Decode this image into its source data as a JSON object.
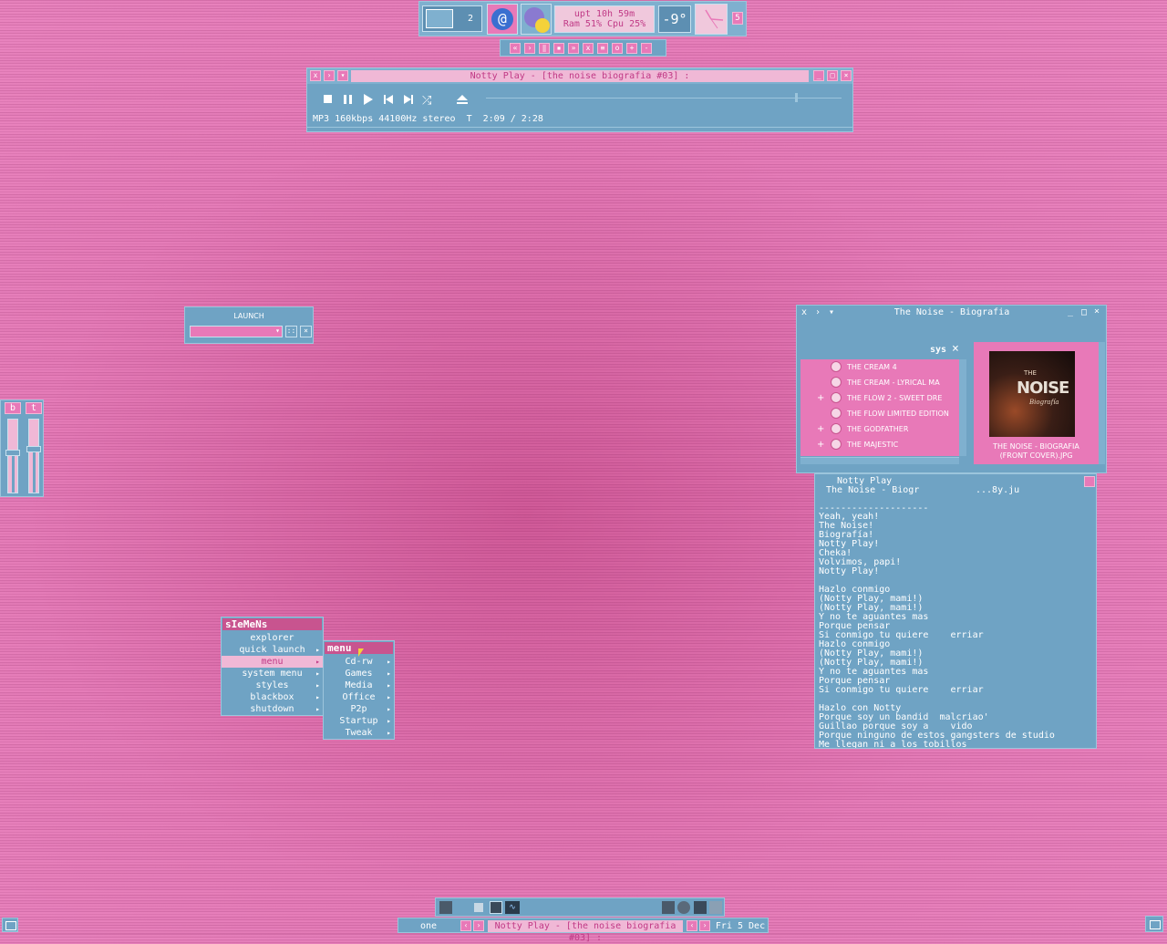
{
  "top_toolbar": {
    "workspace_number": "2",
    "sysinfo_line1": "upt 10h 59m",
    "sysinfo_line2": "Ram 51% Cpu 25%",
    "temperature": "-9°",
    "right_badge": "5"
  },
  "media_controls_strip": [
    "prev",
    "play",
    "pause",
    "stop",
    "next",
    "shuffle",
    "playlist",
    "eq",
    "vol-up",
    "vol-down"
  ],
  "player": {
    "title": "Notty Play - [the noise biografia #03] :",
    "status": "MP3 160kbps 44100Hz stereo  T  2:09 / 2:28",
    "progress": 0.87
  },
  "launch": {
    "title": "LAUNCH",
    "value": ""
  },
  "sliders": {
    "left_label": "b",
    "right_label": "t",
    "left_level": 0.55,
    "right_level": 0.6
  },
  "menu": {
    "title": "sIeMeNs",
    "items": [
      {
        "label": "explorer",
        "arrow": false
      },
      {
        "label": "quick launch",
        "arrow": true
      },
      {
        "label": "menu",
        "arrow": true,
        "active": true
      },
      {
        "label": "system menu",
        "arrow": true
      },
      {
        "label": "styles",
        "arrow": true
      },
      {
        "label": "blackbox",
        "arrow": true
      },
      {
        "label": "shutdown",
        "arrow": true
      }
    ],
    "submenu_title": "menu",
    "submenu_items": [
      "Cd-rw",
      "Games",
      "Media",
      "Office",
      "P2p",
      "Startup",
      "Tweak"
    ]
  },
  "browser": {
    "title": "The Noise - Biografia",
    "tree_header": "sys",
    "tree_items": [
      {
        "label": "THE CREAM 4",
        "expand": ""
      },
      {
        "label": "THE CREAM - LYRICAL MA",
        "expand": ""
      },
      {
        "label": "THE FLOW 2 - SWEET DRE",
        "expand": "+"
      },
      {
        "label": "THE FLOW LIMITED EDITION",
        "expand": ""
      },
      {
        "label": "THE GODFATHER",
        "expand": "+"
      },
      {
        "label": "THE MAJESTIC",
        "expand": "+"
      }
    ],
    "cover_caption_line1": "THE NOISE - BIOGRAFIA",
    "cover_caption_line2": "(FRONT COVER).JPG",
    "cover_art_title": "NOISE",
    "cover_art_small": "THE",
    "cover_art_sub": "Biografía"
  },
  "lyrics": {
    "header1": "Notty Play",
    "header2": "The Noise - Biogr",
    "header3": "...8y.ju",
    "divider": "--------------------",
    "lines": [
      "Yeah, yeah!",
      "The Noise!",
      "Biografía!",
      "Notty Play!",
      "Cheka!",
      "Volvimos, papi!",
      "Notty Play!",
      "",
      "Hazlo conmigo",
      "(Notty Play, mami!)",
      "(Notty Play, mami!)",
      "Y no te aguantes mas",
      "Porque pensar",
      "Si conmigo tu quiere    erriar",
      "Hazlo conmigo",
      "(Notty Play, mami!)",
      "(Notty Play, mami!)",
      "Y no te aguantes mas",
      "Porque pensar",
      "Si conmigo tu quiere    erriar",
      "",
      "Hazlo con Notty",
      "Porque soy un bandid  malcriao'",
      "Guillao porque soy a    vido",
      "Porque ninguno de estos gangsters de studio",
      "Me llegan ni a los tobillos"
    ]
  },
  "taskbar": {
    "workspace": "one",
    "current_task": "Notty Play - [the noise biografia #03] :",
    "date": "Fri 5 Dec"
  },
  "colors": {
    "panel_blue": "#6fa3c4",
    "accent_pink": "#e879b8",
    "desktop_pink": "#e57cb8"
  }
}
